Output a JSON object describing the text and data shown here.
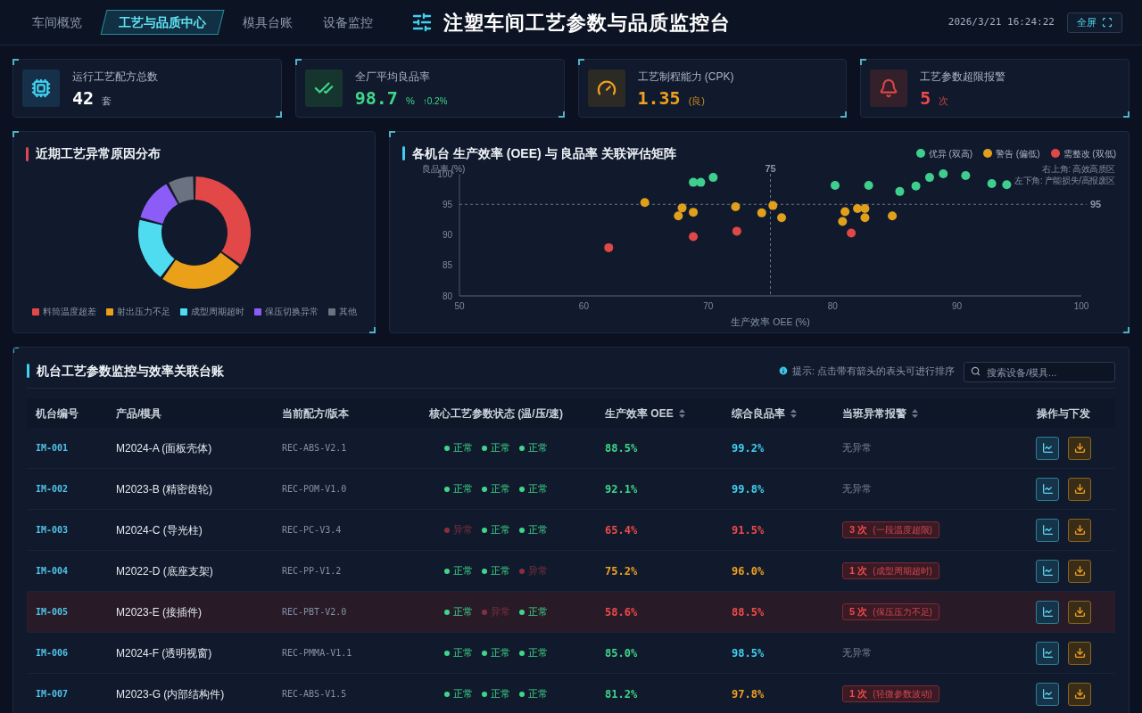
{
  "header": {
    "nav_tabs": [
      {
        "label": "车间概览",
        "selected": false
      },
      {
        "label": "工艺与品质中心",
        "selected": true
      },
      {
        "label": "模具台账",
        "selected": false
      },
      {
        "label": "设备监控",
        "selected": false
      }
    ],
    "title": "注塑车间工艺参数与品质监控台",
    "datetime": "2026/3/21 16:24:22",
    "fullscreen_button": "全屏"
  },
  "kpi_cards": [
    {
      "kind": "recipes",
      "label": "运行工艺配方总数",
      "value": "42",
      "unit": "套"
    },
    {
      "kind": "yield",
      "label": "全厂平均良品率",
      "value": "98.7",
      "unit": "%",
      "trend": "↑0.2%"
    },
    {
      "kind": "cpk",
      "label": "工艺制程能力 (CPK)",
      "value": "1.35",
      "unit": "(良)"
    },
    {
      "kind": "alarm",
      "label": "工艺参数超限报警",
      "value": "5",
      "unit": "次"
    }
  ],
  "anomaly_chart": {
    "title": "近期工艺异常原因分布",
    "chart_data": {
      "type": "donut",
      "categories": [
        "料筒温度超差",
        "射出压力不足",
        "成型周期超时",
        "保压切换异常",
        "其他"
      ],
      "values": [
        35,
        25,
        19,
        13,
        8
      ],
      "colors": [
        "#e24848",
        "#eba019",
        "#4fdcf0",
        "#8b5cf6",
        "#6b7280"
      ],
      "legend": "bottom"
    }
  },
  "scatter_chart": {
    "title": "各机台 生产效率 (OEE) 与 良品率 关联评估矩阵",
    "chart_data": {
      "type": "scatter",
      "xlabel": "生产效率 OEE (%)",
      "ylabel": "良品率 (%)",
      "xlim": [
        50,
        100
      ],
      "ylim": [
        80,
        100
      ],
      "xticks": [
        50,
        60,
        70,
        80,
        90,
        100
      ],
      "yticks": [
        80,
        85,
        90,
        95,
        100
      ],
      "legend": "top",
      "series": [
        {
          "name": "优异 (双高)",
          "color": "#3ecf8e",
          "x": [
            68.8,
            69.4,
            70.4,
            80.2,
            82.9,
            85.4,
            86.7,
            87.8,
            88.9,
            90.7,
            92.8,
            94.0
          ],
          "values": [
            98.6,
            98.6,
            99.4,
            98.1,
            98.1,
            97.1,
            98.0,
            99.4,
            100.0,
            99.7,
            98.4,
            98.2
          ]
        },
        {
          "name": "警告 (偏低)",
          "color": "#e0a01c",
          "x": [
            64.9,
            67.6,
            67.9,
            68.8,
            72.2,
            74.3,
            75.2,
            75.9,
            81.0,
            80.8,
            82.0,
            82.6,
            82.6,
            84.8
          ],
          "values": [
            95.3,
            93.1,
            94.4,
            93.7,
            94.6,
            93.6,
            94.8,
            92.8,
            93.8,
            92.2,
            94.3,
            94.3,
            92.8,
            93.1
          ]
        },
        {
          "name": "需整改 (双低)",
          "color": "#e04848",
          "x": [
            62.0,
            68.8,
            72.3,
            81.5
          ],
          "values": [
            87.9,
            89.7,
            90.6,
            90.3
          ]
        }
      ],
      "ref_lines": [
        {
          "axis": "x",
          "value": 75,
          "label": "75"
        },
        {
          "axis": "y",
          "value": 95,
          "label": "95"
        }
      ],
      "annotations": [
        {
          "text": "右上角: 高效高质区"
        },
        {
          "text": "左下角: 产能损失/高报废区"
        }
      ]
    }
  },
  "table": {
    "title": "机台工艺参数监控与效率关联台账",
    "hint": "提示: 点击带有箭头的表头可进行排序",
    "search": {
      "placeholder": "搜索设备/模具..."
    },
    "columns": [
      {
        "label": "机台编号",
        "sortable": false
      },
      {
        "label": "产品/模具",
        "sortable": false
      },
      {
        "label": "当前配方/版本",
        "sortable": false
      },
      {
        "label": "核心工艺参数状态 (温/压/速)",
        "sortable": false
      },
      {
        "label": "生产效率 OEE",
        "sortable": true
      },
      {
        "label": "综合良品率",
        "sortable": true
      },
      {
        "label": "当班异常报警",
        "sortable": true
      },
      {
        "label": "操作与下发",
        "sortable": false
      }
    ],
    "rows": [
      {
        "critical": false,
        "machine": "IM-001",
        "product": "M2024-A (面板壳体)",
        "recipe": "REC-ABS-V2.1",
        "params": [
          {
            "label": "正常",
            "ok": true
          },
          {
            "label": "正常",
            "ok": true
          },
          {
            "label": "正常",
            "ok": true
          }
        ],
        "oee": {
          "text": "88.5%",
          "color": "#3fd68a"
        },
        "yield": {
          "text": "99.2%",
          "color": "#3fd0f0"
        },
        "alarm": {
          "kind": "none",
          "text": "无异常"
        }
      },
      {
        "critical": false,
        "machine": "IM-002",
        "product": "M2023-B (精密齿轮)",
        "recipe": "REC-POM-V1.0",
        "params": [
          {
            "label": "正常",
            "ok": true
          },
          {
            "label": "正常",
            "ok": true
          },
          {
            "label": "正常",
            "ok": true
          }
        ],
        "oee": {
          "text": "92.1%",
          "color": "#3fd68a"
        },
        "yield": {
          "text": "99.8%",
          "color": "#3fd0f0"
        },
        "alarm": {
          "kind": "none",
          "text": "无异常"
        }
      },
      {
        "critical": false,
        "machine": "IM-003",
        "product": "M2024-C (导光柱)",
        "recipe": "REC-PC-V3.4",
        "params": [
          {
            "label": "异常",
            "ok": false
          },
          {
            "label": "正常",
            "ok": true
          },
          {
            "label": "正常",
            "ok": true
          }
        ],
        "oee": {
          "text": "65.4%",
          "color": "#ef4a4a"
        },
        "yield": {
          "text": "91.5%",
          "color": "#ef4a4a"
        },
        "alarm": {
          "kind": "badge",
          "count": "3 次",
          "note": "(一段温度超限)"
        }
      },
      {
        "critical": false,
        "machine": "IM-004",
        "product": "M2022-D (底座支架)",
        "recipe": "REC-PP-V1.2",
        "params": [
          {
            "label": "正常",
            "ok": true
          },
          {
            "label": "正常",
            "ok": true
          },
          {
            "label": "异常",
            "ok": false
          }
        ],
        "oee": {
          "text": "75.2%",
          "color": "#f0a020"
        },
        "yield": {
          "text": "96.0%",
          "color": "#f0a020"
        },
        "alarm": {
          "kind": "badge",
          "count": "1 次",
          "note": "(成型周期超时)"
        }
      },
      {
        "critical": true,
        "machine": "IM-005",
        "product": "M2023-E (接插件)",
        "recipe": "REC-PBT-V2.0",
        "params": [
          {
            "label": "正常",
            "ok": true
          },
          {
            "label": "异常",
            "ok": false
          },
          {
            "label": "正常",
            "ok": true
          }
        ],
        "oee": {
          "text": "58.6%",
          "color": "#ef4a4a"
        },
        "yield": {
          "text": "88.5%",
          "color": "#ef4a4a"
        },
        "alarm": {
          "kind": "badge",
          "count": "5 次",
          "note": "(保压压力不足)"
        }
      },
      {
        "critical": false,
        "machine": "IM-006",
        "product": "M2024-F (透明视窗)",
        "recipe": "REC-PMMA-V1.1",
        "params": [
          {
            "label": "正常",
            "ok": true
          },
          {
            "label": "正常",
            "ok": true
          },
          {
            "label": "正常",
            "ok": true
          }
        ],
        "oee": {
          "text": "85.0%",
          "color": "#3fd68a"
        },
        "yield": {
          "text": "98.5%",
          "color": "#3fd0f0"
        },
        "alarm": {
          "kind": "none",
          "text": "无异常"
        }
      },
      {
        "critical": false,
        "machine": "IM-007",
        "product": "M2023-G (内部结构件)",
        "recipe": "REC-ABS-V1.5",
        "params": [
          {
            "label": "正常",
            "ok": true
          },
          {
            "label": "正常",
            "ok": true
          },
          {
            "label": "正常",
            "ok": true
          }
        ],
        "oee": {
          "text": "81.2%",
          "color": "#3fd68a"
        },
        "yield": {
          "text": "97.8%",
          "color": "#f0a020"
        },
        "alarm": {
          "kind": "badge",
          "count": "1 次",
          "note": "(轻微参数波动)"
        }
      }
    ]
  }
}
